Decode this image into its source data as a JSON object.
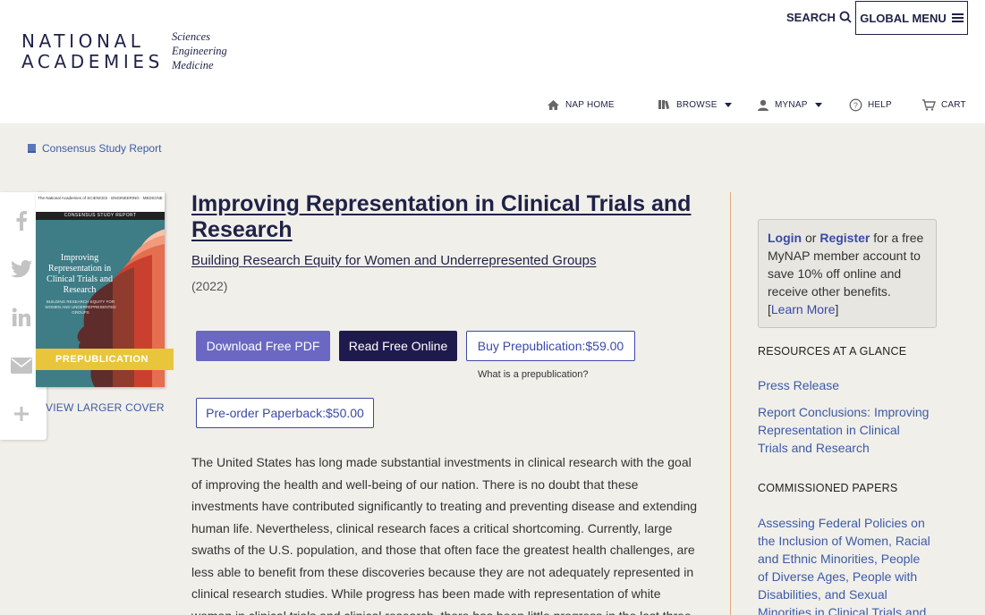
{
  "header": {
    "logo_line1": "NATIONAL",
    "logo_line2": "ACADEMIES",
    "logo_tags": [
      "Sciences",
      "Engineering",
      "Medicine"
    ],
    "search_label": "SEARCH",
    "global_menu_label": "GLOBAL MENU",
    "nav": {
      "home": "NAP HOME",
      "browse": "BROWSE",
      "mynap": "MYNAP",
      "help": "HELP",
      "cart": "CART"
    }
  },
  "breadcrumb": {
    "label": "Consensus Study Report"
  },
  "cover": {
    "top_text": "The National Academies of SCIENCES · ENGINEERING · MEDICINE",
    "band": "CONSENSUS STUDY REPORT",
    "title": "Improving Representation in Clinical Trials and Research",
    "subtitle": "BUILDING RESEARCH EQUITY FOR WOMEN AND UNDERREPRESENTED GROUPS",
    "ribbon": "PREPUBLICATION",
    "view_larger": "VIEW LARGER COVER"
  },
  "book": {
    "title": "Improving Representation in Clinical Trials and Research",
    "subtitle": "Building Research Equity for Women and Underrepresented Groups",
    "year": "(2022)",
    "buttons": {
      "download_pdf": "Download Free PDF",
      "read_online": "Read Free Online",
      "buy": "Buy Prepublication:$59.00",
      "preorder": "Pre-order Paperback:$50.00"
    },
    "what_prepub": "What is a prepublication?",
    "description": "The United States has long made substantial investments in clinical research with the goal of improving the health and well-being of our nation. There is no doubt that these investments have contributed significantly to treating and preventing disease and extending human life. Nevertheless, clinical research faces a critical shortcoming. Currently, large swaths of the U.S. population, and those that often face the greatest health challenges, are less able to benefit from these discoveries because they are not adequately represented in clinical research studies. While progress has been made with representation of white women in clinical trials and clinical research, there has been little progress in the last three"
  },
  "sidebar": {
    "login": {
      "login": "Login",
      "or": " or ",
      "register": "Register",
      "text": " for a free MyNAP member account to save 10% off online and receive other benefits.",
      "bracket_open": "[",
      "learn_more": "Learn More",
      "bracket_close": "]"
    },
    "resources_heading": "RESOURCES AT A GLANCE",
    "resources": [
      "Press Release",
      "Report Conclusions: Improving Representation in Clinical Trials and Research"
    ],
    "papers_heading": "COMMISSIONED PAPERS",
    "papers": [
      "Assessing Federal Policies on the Inclusion of Women, Racial and Ethnic Minorities, People of Diverse Ages, People with Disabilities, and Sexual Minorities in Clinical Trials and"
    ]
  },
  "colors": {
    "navy": "#1f2246",
    "link_blue": "#3b5ba8",
    "pdf_button": "#6a68c2",
    "read_button": "#1f1a4d",
    "prepub_ribbon": "#e8c53a",
    "page_bg": "#f1efea"
  }
}
